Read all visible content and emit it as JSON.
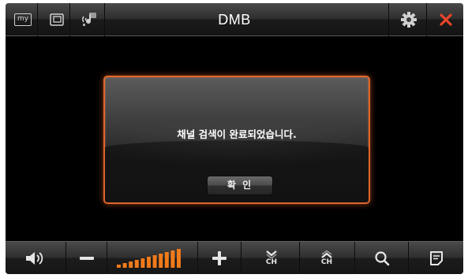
{
  "header": {
    "title": "DMB",
    "my_label": "my"
  },
  "dialog": {
    "message": "채널 검색이 완료되었습니다.",
    "ok_label": "확 인"
  },
  "footer": {
    "channel_down_label": "CH",
    "channel_up_label": "CH"
  },
  "colors": {
    "accent": "#e0662a",
    "close": "#e8442a",
    "volume_bar": "#f07a1a"
  },
  "volume": {
    "level": 1.0,
    "bar_count": 11
  },
  "icons": {
    "top": [
      "my-icon",
      "window-icon",
      "music-icon",
      "gear-icon",
      "close-icon"
    ],
    "bottom": [
      "speaker-icon",
      "minus-icon",
      "plus-icon",
      "channel-down-icon",
      "channel-up-icon",
      "search-icon",
      "memo-icon"
    ]
  }
}
